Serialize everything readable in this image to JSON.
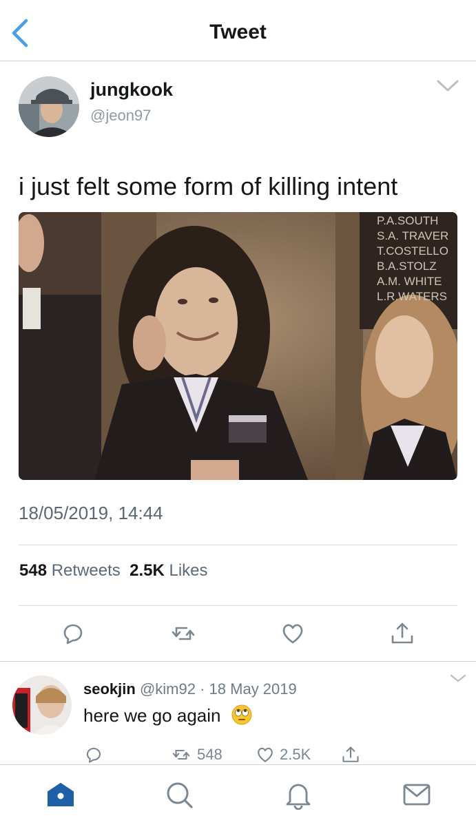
{
  "header": {
    "title": "Tweet"
  },
  "tweet": {
    "author_name": "jungkook",
    "author_handle": "@jeon97",
    "text": "i just felt some form of killing intent",
    "media_board_text": [
      "P.A.SOUTH",
      "S.A. TRAVER",
      "T.COSTELLO",
      "B.A.STOLZ",
      "A.M. WHITE",
      "L.R.WATERS"
    ],
    "timestamp": "18/05/2019, 14:44",
    "retweets_count": "548",
    "retweets_label": "Retweets",
    "likes_count": "2.5K",
    "likes_label": "Likes"
  },
  "reply": {
    "author_name": "seokjin",
    "author_handle": "@kim92",
    "dot": "·",
    "date": "18 May 2019",
    "text": "here we go again",
    "retweets": "548",
    "likes": "2.5K"
  },
  "icons": {
    "back": "chevron-left-icon",
    "more": "chevron-down-icon",
    "reply": "speech-bubble-icon",
    "retweet": "retweet-icon",
    "like": "heart-icon",
    "share": "share-icon",
    "tabs": [
      "home-icon",
      "search-icon",
      "bell-icon",
      "mail-icon"
    ]
  },
  "colors": {
    "accent": "#1da1f2",
    "tab_active": "#1e5fa8",
    "icon_gray": "#7a8792"
  }
}
